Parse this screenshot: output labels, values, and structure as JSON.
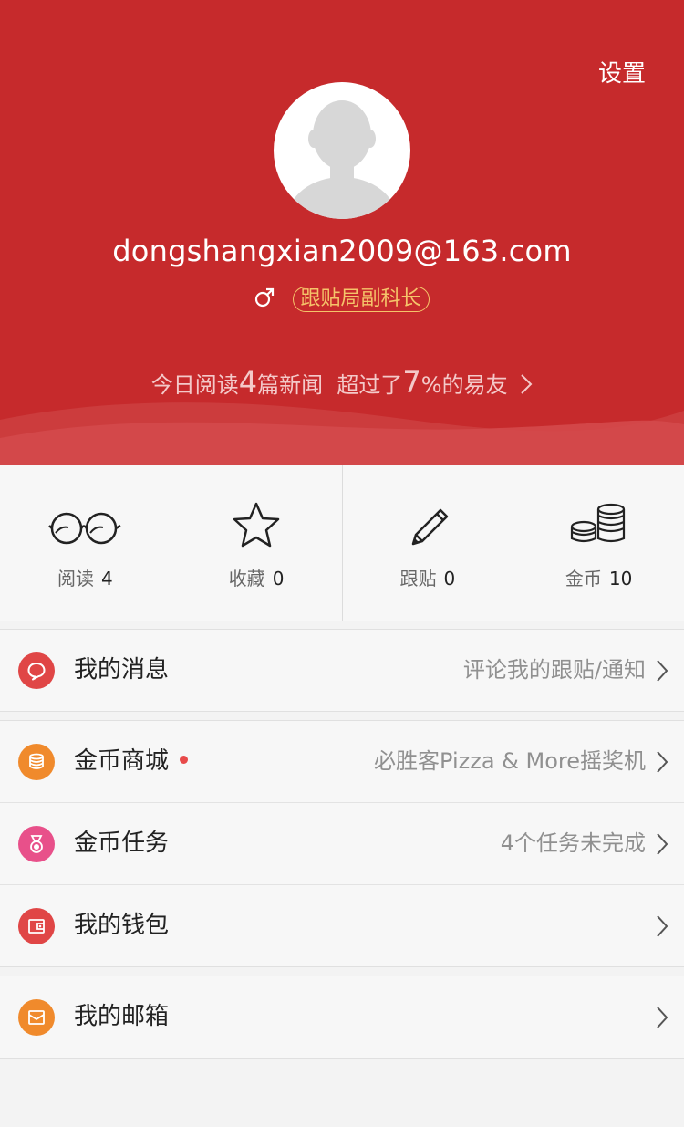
{
  "header": {
    "settings_label": "设置",
    "username": "dongshangxian2009@163.com",
    "gender_symbol": "♂",
    "rank_title": "跟贴局副科长",
    "today": {
      "prefix": "今日阅读",
      "articles_read": "4",
      "mid": "篇新闻  超过了",
      "percent": "7",
      "suffix": "%的易友"
    },
    "colors": {
      "bg": "#c62a2c",
      "badge": "#f5c46a"
    }
  },
  "stats": [
    {
      "label": "阅读",
      "value": "4",
      "icon": "glasses-icon"
    },
    {
      "label": "收藏",
      "value": "0",
      "icon": "star-icon"
    },
    {
      "label": "跟贴",
      "value": "0",
      "icon": "pencil-icon"
    },
    {
      "label": "金币",
      "value": "10",
      "icon": "coins-icon"
    }
  ],
  "menu": {
    "messages": {
      "title": "我的消息",
      "subtitle": "评论我的跟贴/通知",
      "icon": "message-icon",
      "color": "#e04646"
    },
    "coin_shop": {
      "title": "金币商城",
      "subtitle": "必胜客Pizza & More摇奖机",
      "icon": "coin-stack-icon",
      "color": "#f08a2c",
      "has_new_dot": true
    },
    "coin_tasks": {
      "title": "金币任务",
      "subtitle": "4个任务未完成",
      "icon": "medal-icon",
      "color": "#e8508a"
    },
    "wallet": {
      "title": "我的钱包",
      "subtitle": "",
      "icon": "wallet-icon",
      "color": "#e04646"
    },
    "mailbox": {
      "title": "我的邮箱",
      "subtitle": "",
      "icon": "mail-icon",
      "color": "#f08a2c"
    }
  }
}
